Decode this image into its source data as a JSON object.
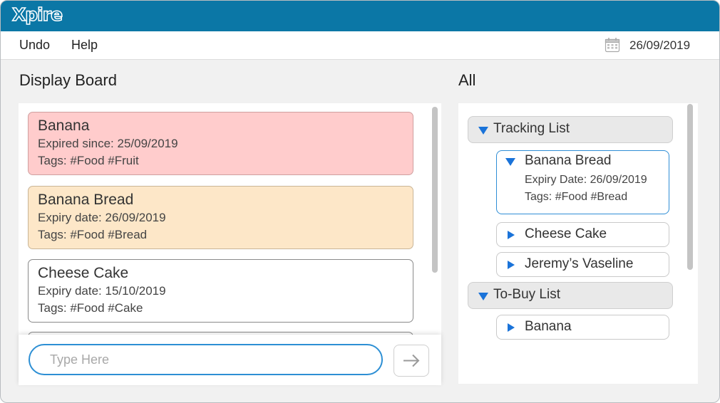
{
  "app": {
    "title": "Xpire"
  },
  "menu": {
    "items": [
      "Undo",
      "Help"
    ],
    "date": "26/09/2019",
    "calendar_icon": "calendar-icon"
  },
  "board": {
    "title": "Display Board",
    "cards": [
      {
        "name": "Banana",
        "date_line": "Expired since: 25/09/2019",
        "tags_line": "Tags: #Food #Fruit",
        "status": "expired",
        "color": "#ffcccc"
      },
      {
        "name": "Banana Bread",
        "date_line": "Expiry date: 26/09/2019",
        "tags_line": "Tags: #Food #Bread",
        "status": "expiring",
        "color": "#fde7c8"
      },
      {
        "name": "Cheese Cake",
        "date_line": "Expiry date: 15/10/2019",
        "tags_line": "Tags: #Food #Cake",
        "status": "normal",
        "color": "#ffffff"
      }
    ]
  },
  "command": {
    "placeholder": "Type Here",
    "value": "",
    "send_icon": "arrow-right-icon"
  },
  "tree": {
    "title": "All",
    "groups": [
      {
        "label": "Tracking List",
        "expanded": true,
        "items": [
          {
            "name": "Banana Bread",
            "expanded": true,
            "date_line": "Expiry Date: 26/09/2019",
            "tags_line": "Tags: #Food #Bread"
          },
          {
            "name": "Cheese Cake",
            "expanded": false
          },
          {
            "name": "Jeremy’s Vaseline",
            "expanded": false
          }
        ]
      },
      {
        "label": "To-Buy List",
        "expanded": true,
        "items": [
          {
            "name": "Banana",
            "expanded": false
          }
        ]
      }
    ]
  },
  "colors": {
    "titlebar": "#0b77a6",
    "accent": "#1a73d9",
    "expired": "#ffcccc",
    "expiring": "#fde7c8"
  }
}
